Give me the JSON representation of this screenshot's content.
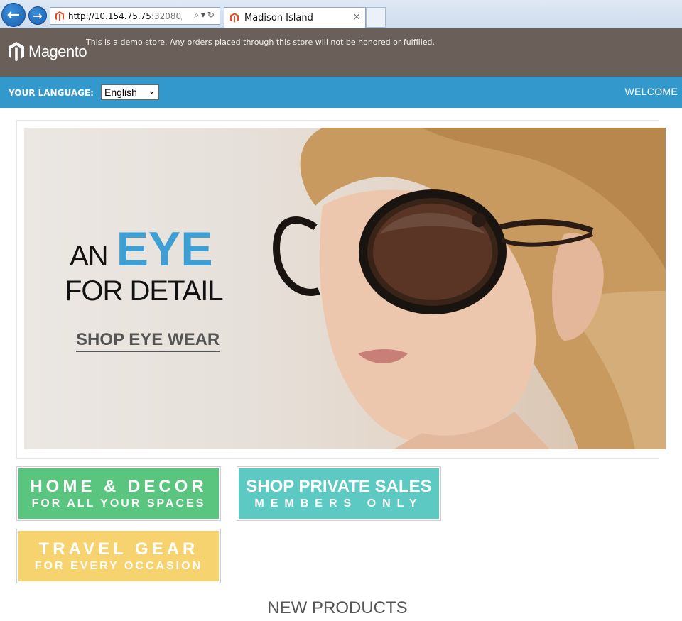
{
  "browser": {
    "url_host": "http://10.154.75.75",
    "url_port": ":32080/",
    "address_tools": "⌕▾↻",
    "tab_title": "Madison Island",
    "tab_close": "×"
  },
  "header": {
    "logo_text": "Magento",
    "demo_notice": "This is a demo store. Any orders placed through this store will not be honored or fulfilled."
  },
  "language_bar": {
    "label": "YOUR LANGUAGE:",
    "selected_language": "English",
    "welcome": "WELCOME"
  },
  "hero": {
    "line1_prefix": "AN",
    "line1_highlight": "EYE",
    "line2": "FOR DETAIL",
    "cta": "SHOP EYE WEAR"
  },
  "promos": [
    {
      "title": "HOME & DECOR",
      "subtitle": "FOR ALL YOUR SPACES"
    },
    {
      "title": "SHOP PRIVATE SALES",
      "subtitle": "MEMBERS ONLY"
    },
    {
      "title": "TRAVEL GEAR",
      "subtitle": "FOR EVERY OCCASION"
    }
  ],
  "section": {
    "new_products_heading": "NEW PRODUCTS"
  },
  "colors": {
    "header_bg": "#6b6059",
    "language_bar_bg": "#3399cc",
    "accent_blue": "#3d9fd4",
    "promo_green": "#5ac57f",
    "promo_teal": "#5dc9c3",
    "promo_yellow": "#f7d36f"
  }
}
